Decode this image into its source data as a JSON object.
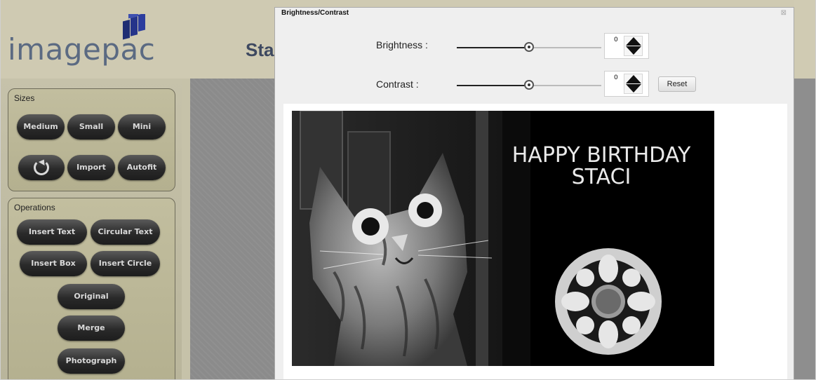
{
  "app": {
    "logo_text": "imagepac",
    "page_title_partial": "Sta"
  },
  "sidebar": {
    "sizes": {
      "title": "Sizes",
      "buttons": [
        "Medium",
        "Small",
        "Mini"
      ],
      "row2": [
        "Import",
        "Autofit"
      ],
      "rotate_icon": "rotate-icon"
    },
    "operations": {
      "title": "Operations",
      "buttons": [
        "Insert Text",
        "Circular Text",
        "Insert Box",
        "Insert Circle",
        "Original",
        "Merge",
        "Photograph"
      ]
    }
  },
  "dialog": {
    "title": "Brightness/Contrast",
    "close_icon": "close-icon",
    "brightness": {
      "label": "Brightness :",
      "value": "0",
      "slider_fraction": 0.5
    },
    "contrast": {
      "label": "Contrast :",
      "value": "0",
      "slider_fraction": 0.5
    },
    "reset_label": "Reset",
    "preview": {
      "text_line1": "HAPPY BIRTHDAY",
      "text_line2": "STACI"
    }
  },
  "colors": {
    "header_bg": "#cfcab2",
    "logo": "#5b6a82",
    "pill_bg": "#2a2a2a",
    "workspace": "#8b8b8b"
  }
}
